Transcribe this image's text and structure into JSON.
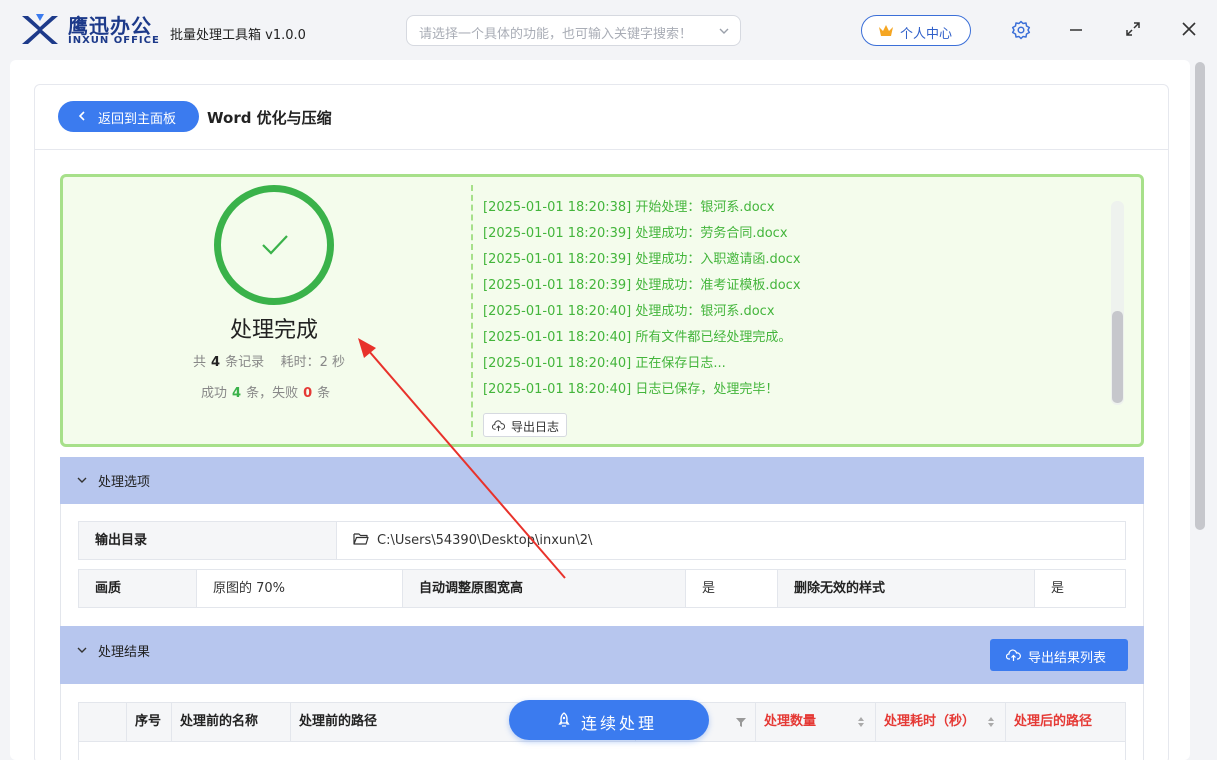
{
  "app": {
    "brand_cn": "鹰迅办公",
    "brand_en": "INXUN OFFICE",
    "title": "批量处理工具箱 v1.0.0"
  },
  "search": {
    "placeholder": "请选择一个具体的功能，也可输入关键字搜索！"
  },
  "user_center": {
    "label": "个人中心"
  },
  "page": {
    "back_label": "返回到主面板",
    "title": "Word 优化与压缩"
  },
  "summary": {
    "status": "处理完成",
    "total_prefix": "共",
    "total": "4",
    "total_suffix": "条记录",
    "time_prefix": "耗时：",
    "time_value": "2",
    "time_suffix": "秒",
    "success_prefix": "成功",
    "success": "4",
    "success_suffix": "条，失败",
    "fail": "0",
    "fail_suffix": "条"
  },
  "log": {
    "lines": [
      "[2025-01-01 18:20:38] 开始处理：银河系.docx",
      "[2025-01-01 18:20:39] 处理成功：劳务合同.docx",
      "[2025-01-01 18:20:39] 处理成功：入职邀请函.docx",
      "[2025-01-01 18:20:39] 处理成功：准考证模板.docx",
      "[2025-01-01 18:20:40] 处理成功：银河系.docx",
      "[2025-01-01 18:20:40] 所有文件都已经处理完成。",
      "[2025-01-01 18:20:40] 正在保存日志...",
      "[2025-01-01 18:20:40] 日志已保存，处理完毕！"
    ],
    "export_label": "导出日志"
  },
  "options": {
    "section_label": "处理选项",
    "output_dir_label": "输出目录",
    "output_dir_value": "C:\\Users\\54390\\Desktop\\inxun\\2\\",
    "quality_label": "画质",
    "quality_value": "原图的 70%",
    "auto_resize_label": "自动调整原图宽高",
    "auto_resize_value": "是",
    "remove_styles_label": "删除无效的样式",
    "remove_styles_value": "是"
  },
  "results": {
    "section_label": "处理结果",
    "export_label": "导出结果列表",
    "columns": [
      "序号",
      "处理前的名称",
      "处理前的路径",
      "处理数量",
      "处理耗时（秒）",
      "处理后的路径"
    ]
  },
  "continue": {
    "label": "连续处理"
  },
  "colors": {
    "accent": "#3b7bef",
    "success": "#3ab24a",
    "log_text": "#43b53b",
    "section_header": "#b7c6ee",
    "danger": "#e53935"
  }
}
